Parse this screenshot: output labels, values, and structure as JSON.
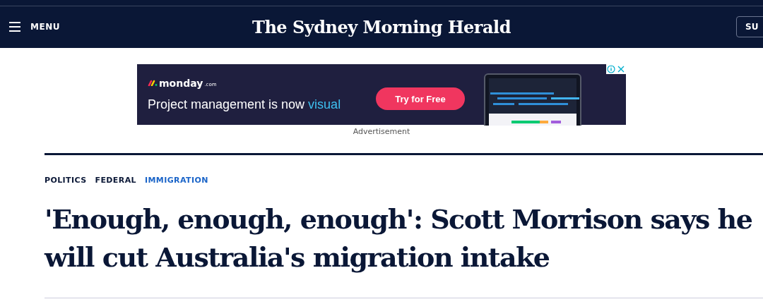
{
  "header": {
    "menu_label": "MENU",
    "logo": "The Sydney Morning Herald",
    "subscribe_label": "SU"
  },
  "ad": {
    "brand": "monday",
    "brand_suffix": ".com",
    "headline": "Project management is now",
    "headline_highlight": "visual",
    "cta": "Try for Free",
    "caption": "Advertisement"
  },
  "breadcrumbs": [
    {
      "label": "POLITICS",
      "selected": false
    },
    {
      "label": "FEDERAL",
      "selected": false
    },
    {
      "label": "IMMIGRATION",
      "selected": true
    }
  ],
  "article": {
    "headline": "'Enough, enough, enough': Scott Morrison says he will cut Australia's migration intake"
  }
}
